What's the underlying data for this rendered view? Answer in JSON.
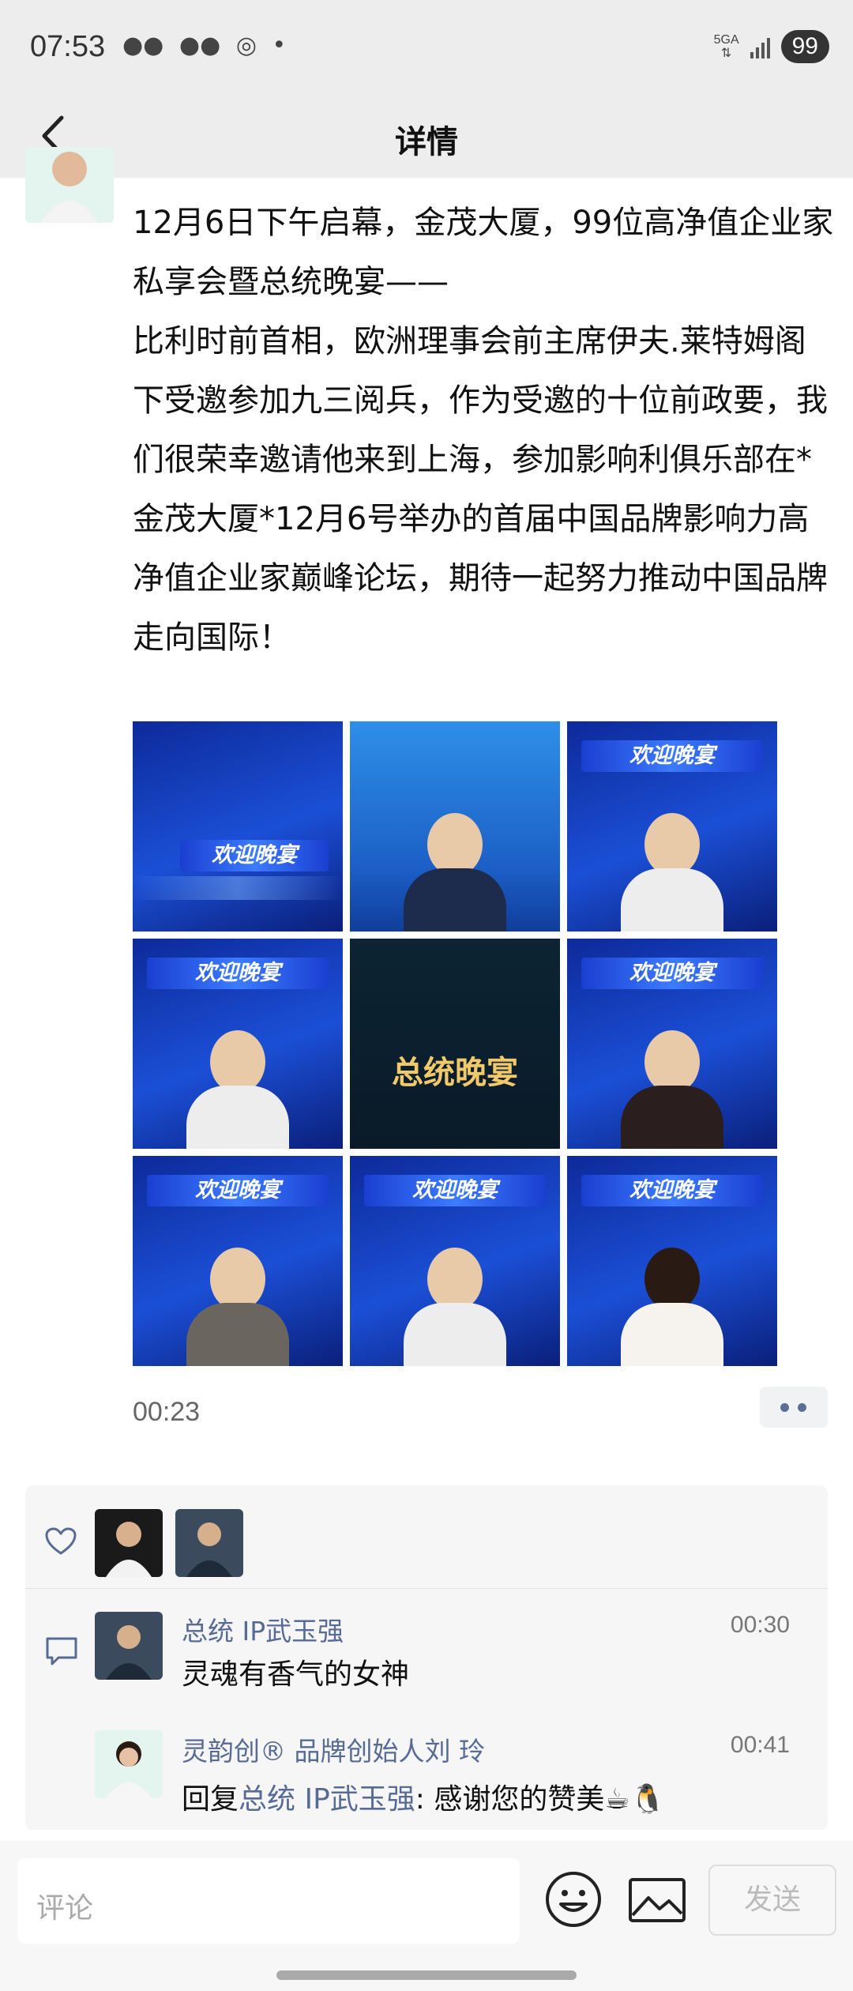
{
  "status": {
    "time": "07:53",
    "network": "5GA",
    "battery": "99"
  },
  "nav": {
    "title": "详情"
  },
  "post": {
    "text": "12月6日下午启幕，金茂大厦，99位高净值企业家私享会暨总统晚宴——\n比利时前首相，欧洲理事会前主席伊夫.莱特姆阁下受邀参加九三阅兵，作为受邀的十位前政要，我们很荣幸邀请他来到上海，参加影响利俱乐部在*金茂大厦*12月6号举办的首届中国品牌影响力高净值企业家巅峰论坛，期待一起努力推动中国品牌走向国际！",
    "video_time": "00:23",
    "tiles": [
      {
        "banner": "欢迎晚宴"
      },
      {
        "banner": ""
      },
      {
        "banner": "欢迎晚宴"
      },
      {
        "banner": "欢迎晚宴"
      },
      {
        "banner": "总统晚宴"
      },
      {
        "banner": "欢迎晚宴"
      },
      {
        "banner": "欢迎晚宴"
      },
      {
        "banner": "欢迎晚宴"
      },
      {
        "banner": "欢迎晚宴"
      }
    ]
  },
  "comments": [
    {
      "author": "总统 IP武玉强",
      "time": "00:30",
      "text": "灵魂有香气的女神"
    },
    {
      "author": "灵韵创® 品牌创始人刘 玲",
      "time": "00:41",
      "reply_prefix": "回复",
      "reply_to": "总统 IP武玉强",
      "text": ": 感谢您的赞美☕🐧"
    }
  ],
  "input": {
    "placeholder": "评论",
    "send_label": "发送"
  },
  "icons": {
    "back": "back-arrow-icon",
    "like": "heart-icon",
    "comment": "comment-icon",
    "emoji": "emoji-icon",
    "image": "image-icon",
    "more": "more-dots-icon"
  }
}
